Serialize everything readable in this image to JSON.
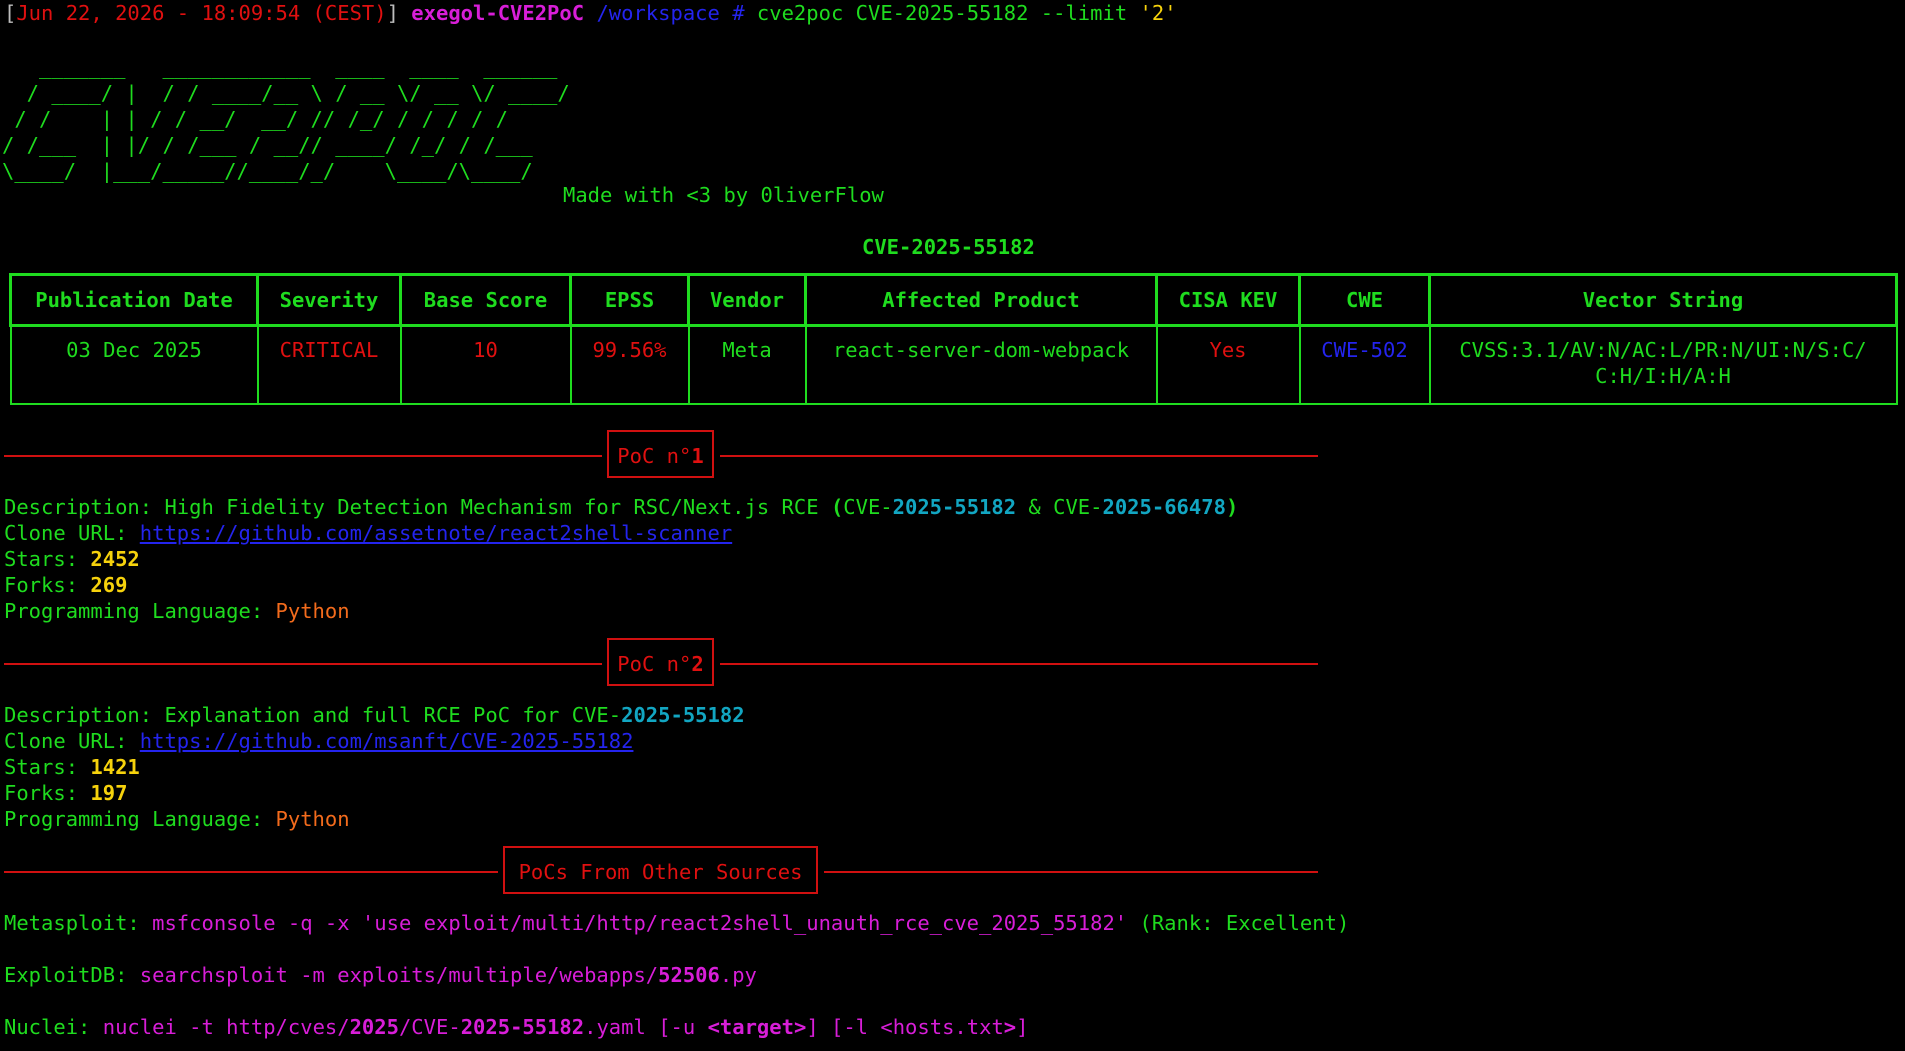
{
  "prompt": {
    "open_bracket": "[",
    "datetime": "Jun 22, 2026 - 18:09:54 (CEST)",
    "close_bracket": "]",
    "host": "exegol-CVE2PoC",
    "cwd": "/workspace",
    "symbol": "#",
    "command": "cve2poc",
    "arg_cve": "CVE-2025-55182",
    "arg_flag": "--limit",
    "arg_value": "'2'"
  },
  "banner": {
    "ascii": "   _______   ____________  ____  ____  ______\n  / ____/ |  / / ____/__ \\ / __ \\/ __ \\/ ____/\n / /    | | / / __/  __/ // /_/ / / / / /     \n/ /___  | |/ / /___ / __// ____/ /_/ / /___   \n\\____/  |___/_____//____/_/    \\____/\\____/   ",
    "made_with": "Made with <3 by 0liverFlow"
  },
  "cve_id": "CVE-2025-55182",
  "table": {
    "headers": [
      "Publication Date",
      "Severity",
      "Base Score",
      "EPSS",
      "Vendor",
      "Affected Product",
      "CISA KEV",
      "CWE",
      "Vector String"
    ],
    "row": {
      "publication_date": "03 Dec 2025",
      "severity": "CRITICAL",
      "base_score": "10",
      "epss": "99.56%",
      "vendor": "Meta",
      "affected_product": "react-server-dom-webpack",
      "cisa_kev": "Yes",
      "cwe": "CWE-502",
      "vector_line1": "CVSS:3.1/AV:N/AC:L/PR:N/UI:N/S:C/",
      "vector_line2": "C:H/I:H/A:H"
    }
  },
  "pocs": [
    {
      "header_prefix": "PoC n°",
      "header_number": "1",
      "desc_label": "Description: ",
      "desc_text": "High Fidelity Detection Mechanism for RSC/Next.js RCE ",
      "desc_paren_open": "(",
      "desc_cve1_prefix": "CVE-",
      "desc_cve1_year": "2025",
      "desc_cve1_sep": "-",
      "desc_cve1_num": "55182",
      "desc_amp": " & ",
      "desc_cve2_prefix": "CVE-",
      "desc_cve2_year": "2025",
      "desc_cve2_sep": "-",
      "desc_cve2_num": "66478",
      "desc_paren_close": ")",
      "clone_label": "Clone URL: ",
      "clone_url": "https://github.com/assetnote/react2shell-scanner",
      "stars_label": "Stars: ",
      "stars": "2452",
      "forks_label": "Forks: ",
      "forks": "269",
      "lang_label": "Programming Language: ",
      "lang": "Python"
    },
    {
      "header_prefix": "PoC n°",
      "header_number": "2",
      "desc_label": "Description: ",
      "desc_text": "Explanation and full RCE PoC for ",
      "desc_cve1_prefix": "CVE-",
      "desc_cve1_year": "2025",
      "desc_cve1_sep": "-",
      "desc_cve1_num": "55182",
      "clone_label": "Clone URL: ",
      "clone_url": "https://github.com/msanft/CVE-2025-55182",
      "stars_label": "Stars: ",
      "stars": "1421",
      "forks_label": "Forks: ",
      "forks": "197",
      "lang_label": "Programming Language: ",
      "lang": "Python"
    }
  ],
  "other_sources": {
    "header": "PoCs From Other Sources",
    "metasploit_label": "Metasploit: ",
    "metasploit_cmd": "msfconsole -q -x 'use exploit/multi/http/react2shell_unauth_rce_cve_2025_55182'",
    "metasploit_rank": " (Rank: Excellent)",
    "exploitdb_label": "ExploitDB: ",
    "exploitdb_cmd_prefix": "searchsploit -m exploits/multiple/webapps/",
    "exploitdb_id": "52506",
    "exploitdb_ext": ".py",
    "nuclei_label": "Nuclei: ",
    "nuclei_cmd_prefix": "nuclei -t http/cves/",
    "nuclei_year": "2025",
    "nuclei_path_mid": "/CVE-",
    "nuclei_cve_year": "2025",
    "nuclei_sep": "-",
    "nuclei_cve_num": "55182",
    "nuclei_ext": ".yaml ",
    "nuclei_opt1_open": "[-u ",
    "nuclei_opt1_lt": "<",
    "nuclei_opt1_arg": "target",
    "nuclei_opt1_gt": ">",
    "nuclei_opt1_close": "]",
    "nuclei_space": " ",
    "nuclei_opt2_open": "[-l ",
    "nuclei_opt2_arg": "<hosts.txt",
    "nuclei_opt2_gt": ">",
    "nuclei_opt2_close": "]"
  },
  "colors": {
    "terminal_bg": "#000000",
    "green": "#1fdc1f",
    "red": "#e01010",
    "magenta": "#d81ed8",
    "blue": "#2424ee",
    "cyan": "#12a6c2",
    "yellow": "#f6d20c",
    "orange": "#f36b1c"
  }
}
